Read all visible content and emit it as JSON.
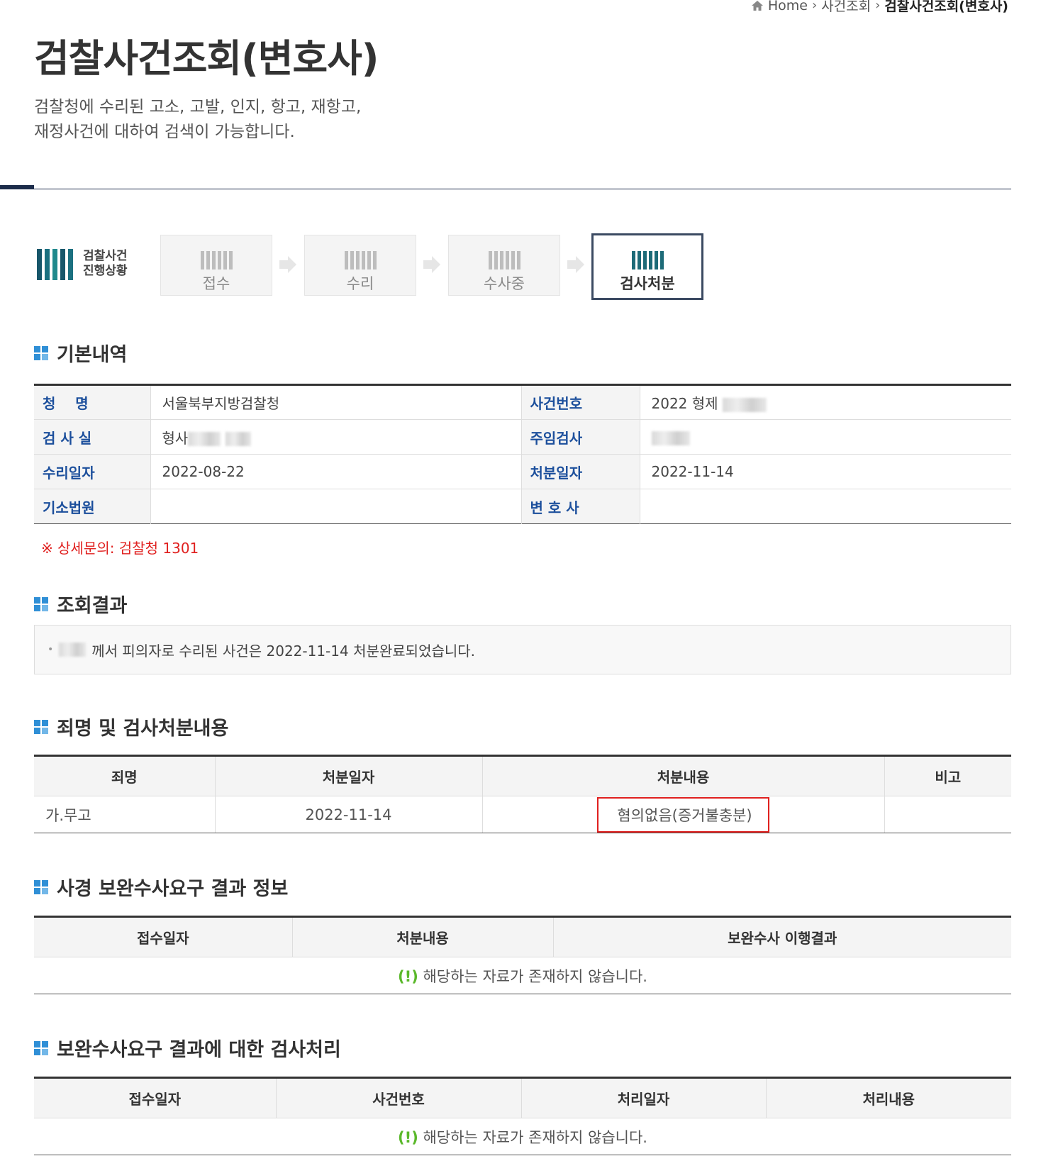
{
  "breadcrumb": {
    "home": "Home",
    "level1": "사건조회",
    "current": "검찰사건조회(변호사)"
  },
  "page": {
    "title": "검찰사건조회(변호사)",
    "desc_line1": "검찰청에 수리된 고소, 고발, 인지, 항고, 재항고,",
    "desc_line2": "재정사건에 대하여 검색이 가능합니다."
  },
  "progress": {
    "logo_line1": "검찰사건",
    "logo_line2": "진행상황",
    "steps": [
      {
        "label": "접수",
        "active": false
      },
      {
        "label": "수리",
        "active": false
      },
      {
        "label": "수사중",
        "active": false
      },
      {
        "label": "검사처분",
        "active": true
      }
    ]
  },
  "basic": {
    "heading": "기본내역",
    "rows": [
      {
        "l1": "청    명",
        "v1": "서울북부지방검찰청",
        "l2": "사건번호",
        "v2": "2022 형제"
      },
      {
        "l1": "검 사 실",
        "v1": "형사",
        "l2": "주임검사",
        "v2": ""
      },
      {
        "l1": "수리일자",
        "v1": "2022-08-22",
        "l2": "처분일자",
        "v2": "2022-11-14"
      },
      {
        "l1": "기소법원",
        "v1": "",
        "l2": "변 호 사",
        "v2": ""
      }
    ],
    "notice": "※ 상세문의: 검찰청 1301"
  },
  "result": {
    "heading": "조회결과",
    "text": "께서 피의자로 수리된 사건은 2022-11-14 처분완료되었습니다."
  },
  "charges": {
    "heading": "죄명 및 검사처분내용",
    "columns": [
      "죄명",
      "처분일자",
      "처분내용",
      "비고"
    ],
    "rows": [
      {
        "charge": "가.무고",
        "date": "2022-11-14",
        "disposition": "혐의없음(증거불충분)",
        "note": ""
      }
    ]
  },
  "supplement_police": {
    "heading": "사경 보완수사요구 결과 정보",
    "columns": [
      "접수일자",
      "처분내용",
      "보완수사 이행결과"
    ],
    "empty_mark": "(!)",
    "empty_text": "해당하는 자료가 존재하지 않습니다."
  },
  "supplement_prosecutor": {
    "heading": "보완수사요구 결과에 대한 검사처리",
    "columns": [
      "접수일자",
      "사건번호",
      "처리일자",
      "처리내용"
    ],
    "empty_mark": "(!)",
    "empty_text": "해당하는 자료가 존재하지 않습니다."
  }
}
